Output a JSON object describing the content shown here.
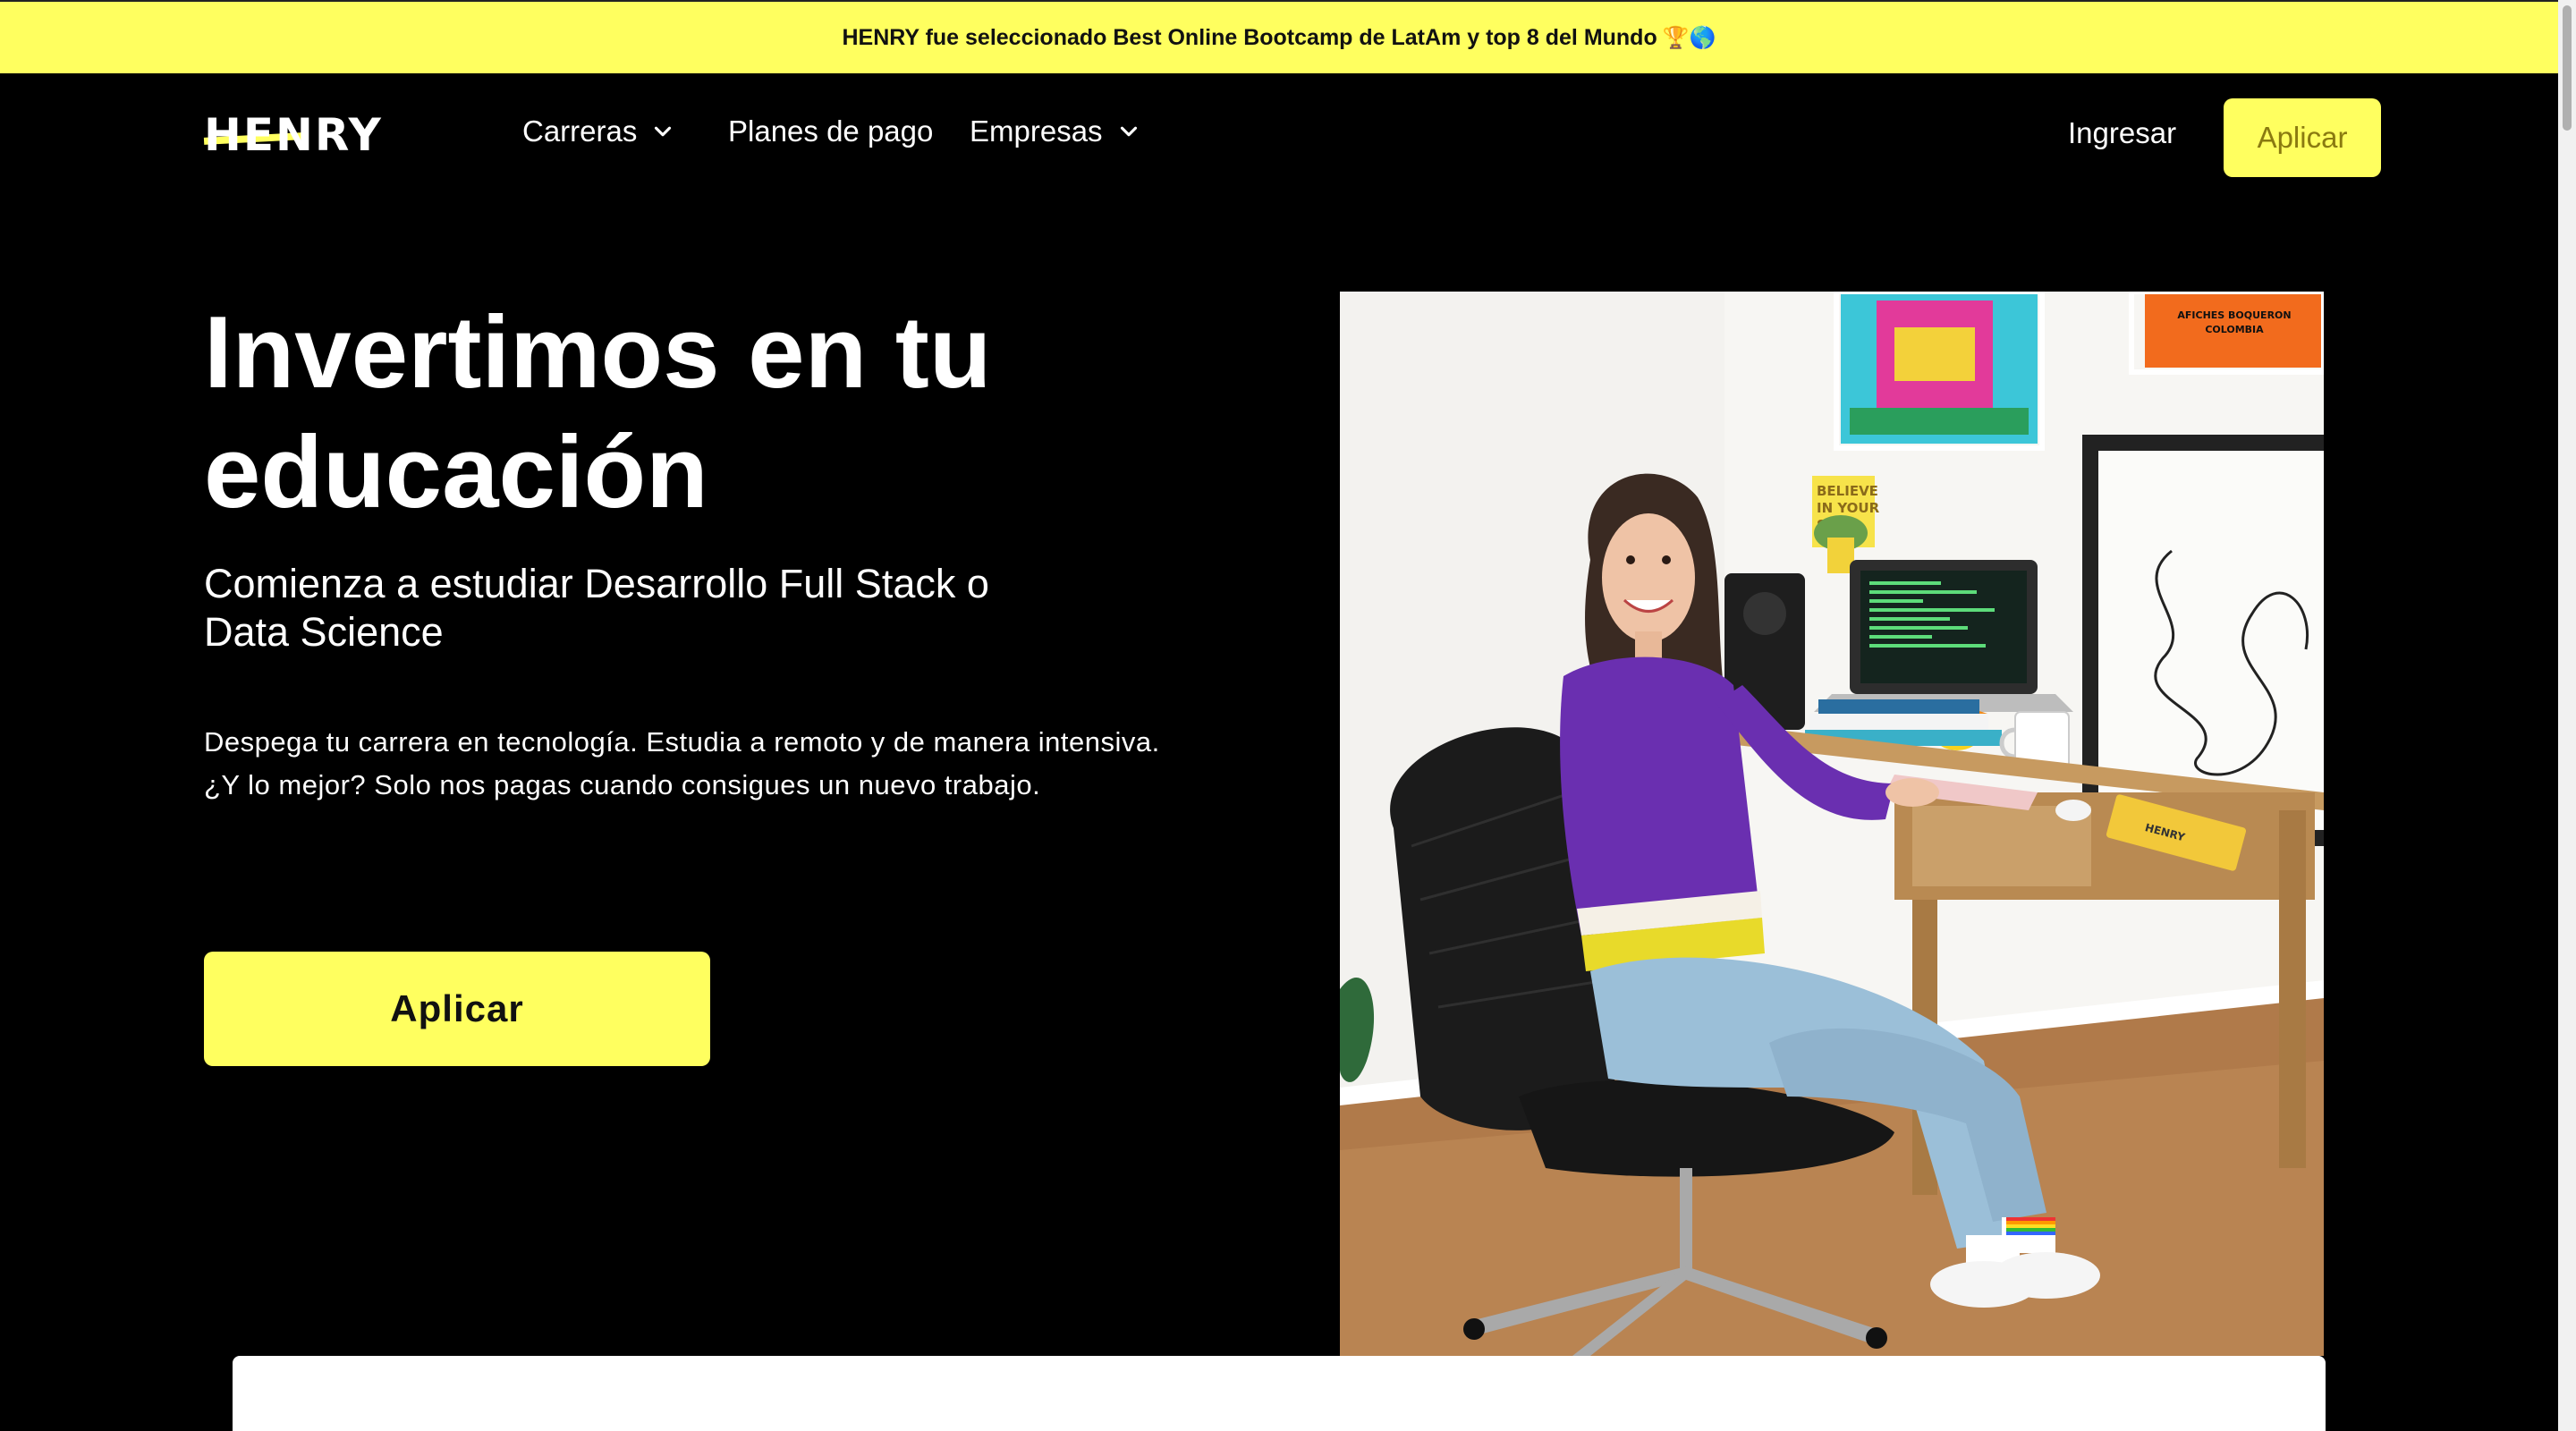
{
  "banner": {
    "text": "HENRY fue seleccionado Best Online Bootcamp de LatAm y top 8 del Mundo",
    "emoji": "🏆🌎"
  },
  "nav": {
    "logo": "HENRY",
    "items": [
      {
        "label": "Carreras",
        "dropdown": true
      },
      {
        "label": "Planes de pago",
        "dropdown": false
      },
      {
        "label": "Empresas",
        "dropdown": true
      }
    ],
    "login": "Ingresar",
    "apply": "Aplicar"
  },
  "hero": {
    "title_line1": "Invertimos en tu",
    "title_line2": "educación",
    "subtitle_line1": "Comienza a estudiar Desarrollo Full Stack o",
    "subtitle_line2": "Data Science",
    "desc_line1": "Despega tu carrera en tecnología. Estudia a remoto y de manera intensiva.",
    "desc_line2": "¿Y lo mejor? Solo nos pagas cuando consigues un nuevo trabajo.",
    "button": "Aplicar"
  },
  "photo": {
    "poster_text": "AFICHES BOQUERON · COLOMBIA",
    "sign_text": "BELIEVE IN YOUR SELF",
    "notebook_text": "HENRY"
  },
  "colors": {
    "accent": "#FFFF5F",
    "background": "#000000",
    "text": "#FFFFFF",
    "sweater": "#6A2FB0"
  }
}
